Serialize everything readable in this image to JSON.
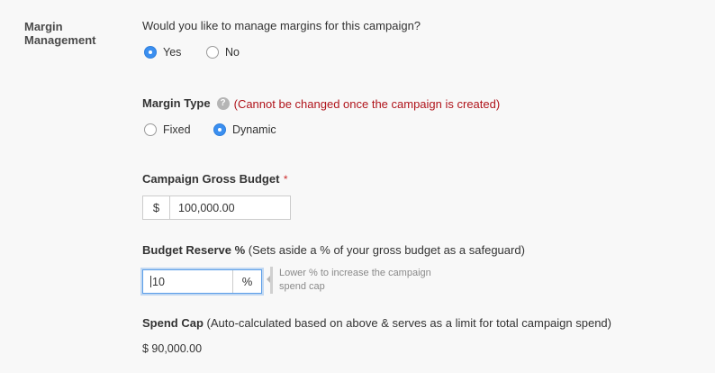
{
  "section": {
    "label": "Margin Management"
  },
  "manage_margins": {
    "question": "Would you like to manage margins for this campaign?",
    "options": [
      {
        "label": "Yes",
        "checked": true
      },
      {
        "label": "No",
        "checked": false
      }
    ]
  },
  "margin_type": {
    "label": "Margin Type",
    "help_icon": "question-icon",
    "warning": "(Cannot be changed once the campaign is created)",
    "options": [
      {
        "label": "Fixed",
        "checked": false
      },
      {
        "label": "Dynamic",
        "checked": true
      }
    ]
  },
  "gross_budget": {
    "label": "Campaign Gross Budget",
    "required_mark": "*",
    "prefix": "$",
    "value": "100,000.00"
  },
  "budget_reserve": {
    "label": "Budget Reserve %",
    "description": "(Sets aside a % of your gross budget as a safeguard)",
    "value": "10",
    "suffix": "%",
    "hint_line1": "Lower % to increase the campaign",
    "hint_line2": "spend cap"
  },
  "spend_cap": {
    "label": "Spend Cap",
    "description": "(Auto-calculated based on above & serves as a limit for total campaign spend)",
    "value": "$ 90,000.00"
  },
  "colors": {
    "accent": "#3b8ff0",
    "warning": "#b0141b",
    "background": "#f8f8f8"
  }
}
